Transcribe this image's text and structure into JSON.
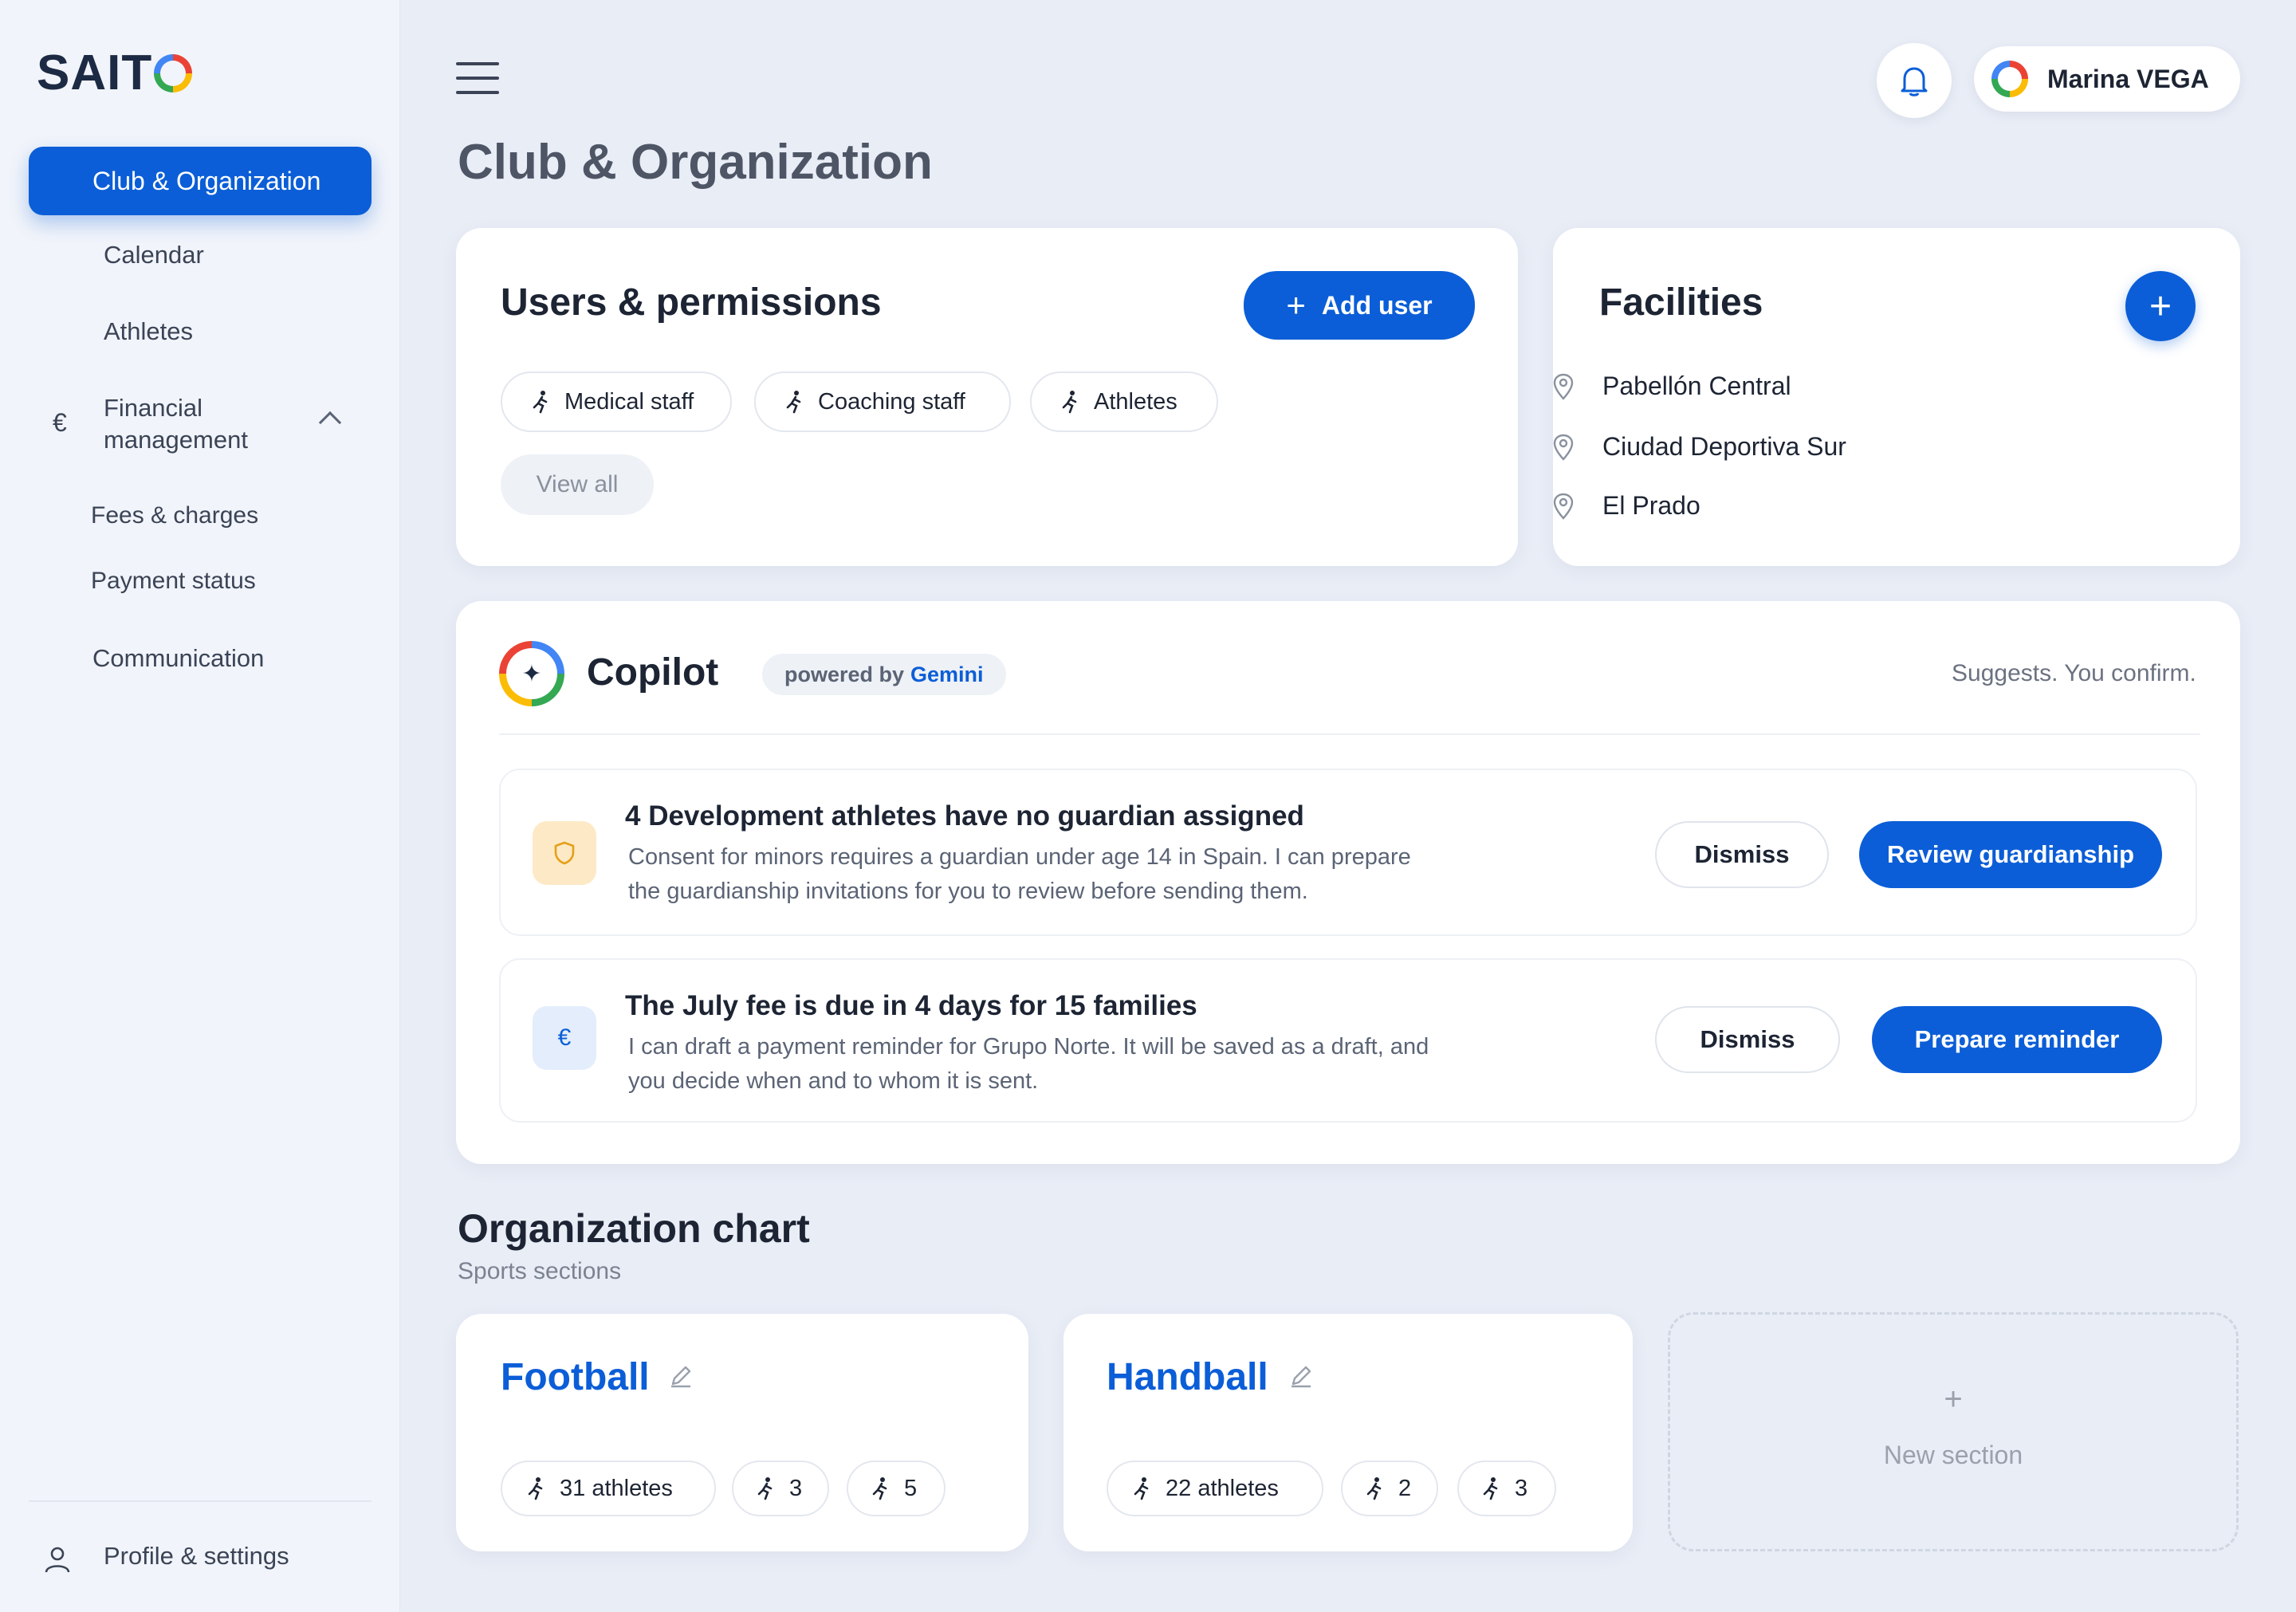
{
  "app": {
    "logo": "SAIT"
  },
  "sidebar": {
    "active": "Club & Organization",
    "calendar": "Calendar",
    "athletes": "Athletes",
    "financial": "Financial management",
    "fees": "Fees & charges",
    "payment": "Payment status",
    "communication": "Communication",
    "profile": "Profile & settings"
  },
  "header": {
    "user_name": "Marina VEGA"
  },
  "page": {
    "title": "Club & Organization"
  },
  "users_card": {
    "title": "Users & permissions",
    "add_user": "Add user",
    "chips": [
      "Medical staff",
      "Coaching staff",
      "Athletes"
    ],
    "view_all": "View all"
  },
  "facilities_card": {
    "title": "Facilities",
    "add": "+",
    "items": [
      "Pabellón Central",
      "Ciudad Deportiva Sur",
      "El Prado"
    ]
  },
  "copilot": {
    "name": "Copilot",
    "powered_prefix": "powered by",
    "powered_brand": "Gemini",
    "tagline": "Suggests. You confirm.",
    "suggestions": [
      {
        "title": "4 Development athletes have no guardian assigned",
        "body": "Consent for minors requires a guardian under age 14 in Spain. I can prepare the guardianship invitations for you to review before sending them.",
        "dismiss": "Dismiss",
        "action": "Review guardianship"
      },
      {
        "title": "The July fee is due in 4 days for 15 families",
        "body": "I can draft a payment reminder for Grupo Norte. It will be saved as a draft, and you decide when and to whom it is sent.",
        "dismiss": "Dismiss",
        "action": "Prepare reminder"
      }
    ]
  },
  "org_chart": {
    "title": "Organization chart",
    "subtitle": "Sports sections",
    "sections": [
      {
        "name": "Football",
        "athletes": "31 athletes",
        "count_a": "3",
        "count_b": "5"
      },
      {
        "name": "Handball",
        "athletes": "22 athletes",
        "count_a": "2",
        "count_b": "3"
      }
    ],
    "new_plus": "+",
    "new_label": "New section"
  },
  "colors": {
    "accent": "#0b5ed7",
    "background": "#e9edf6",
    "sidebar": "#f1f4fa"
  },
  "icons": [
    "menu-icon",
    "bell-icon",
    "euro-icon",
    "chevron-up-icon",
    "person-icon",
    "runner-icon",
    "location-pin-icon",
    "shield-icon",
    "pencil-icon",
    "plus-icon",
    "sparkle-icon"
  ]
}
